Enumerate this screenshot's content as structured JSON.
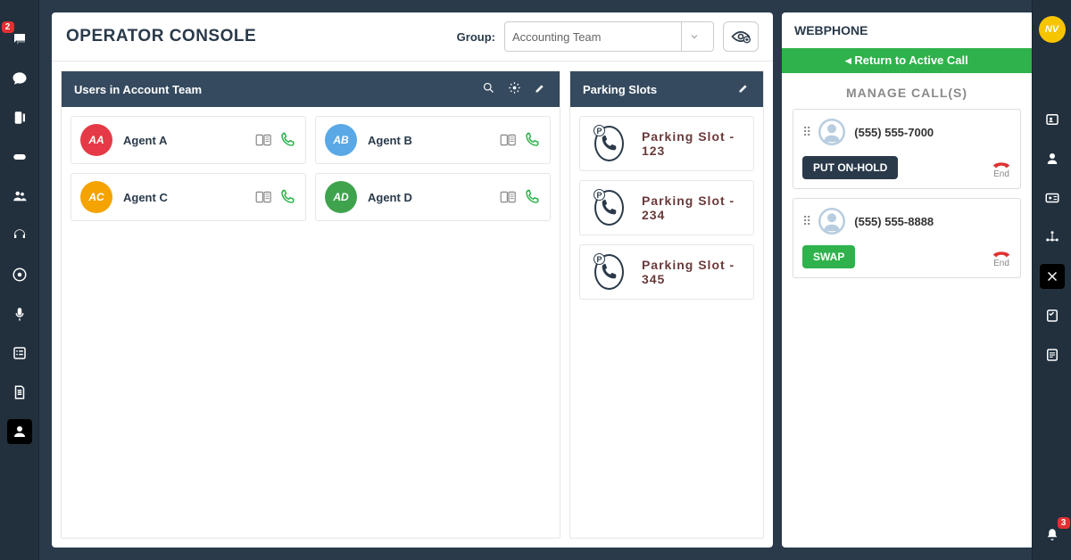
{
  "left_rail": {
    "badge": "2"
  },
  "right_rail": {
    "avatar": "NV",
    "bell_badge": "3"
  },
  "header": {
    "title": "OPERATOR CONSOLE",
    "group_label": "Group:",
    "group_selected": "Accounting Team"
  },
  "users_panel": {
    "title": "Users in Account Team",
    "users": [
      {
        "initials": "AA",
        "name": "Agent A",
        "color": "#e63946"
      },
      {
        "initials": "AB",
        "name": "Agent B",
        "color": "#5aa9e6"
      },
      {
        "initials": "AC",
        "name": "Agent C",
        "color": "#f4a300"
      },
      {
        "initials": "AD",
        "name": "Agent D",
        "color": "#3fa34d"
      }
    ]
  },
  "parking_panel": {
    "title": "Parking Slots",
    "slots": [
      {
        "label": "Parking Slot - 123"
      },
      {
        "label": "Parking Slot - 234"
      },
      {
        "label": "Parking Slot - 345"
      }
    ]
  },
  "webphone": {
    "title": "WEBPHONE",
    "return_label": "◂ Return to Active Call",
    "manage_label": "MANAGE CALL(S)",
    "hold_label": "PUT ON-HOLD",
    "swap_label": "SWAP",
    "end_label": "End",
    "calls": [
      {
        "number": "(555) 555-7000",
        "action": "hold"
      },
      {
        "number": "(555) 555-8888",
        "action": "swap"
      }
    ]
  }
}
